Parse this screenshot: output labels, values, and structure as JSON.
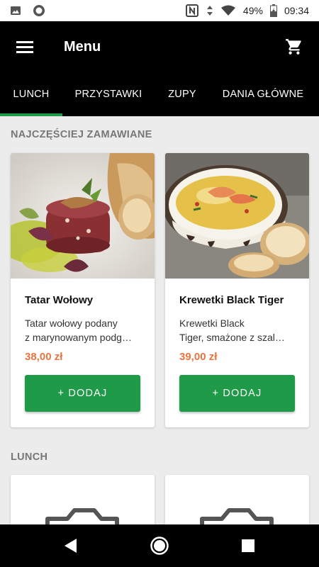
{
  "status_bar": {
    "battery": "49%",
    "time": "09:34",
    "icons": [
      "image-icon",
      "record-icon",
      "nfc-icon",
      "data-arrows-icon",
      "wifi-icon",
      "battery-icon"
    ]
  },
  "toolbar": {
    "title": "Menu",
    "menu_icon": "hamburger-icon",
    "cart_icon": "cart-icon"
  },
  "tabs": [
    {
      "label": "LUNCH",
      "active": true
    },
    {
      "label": "PRZYSTAWKI",
      "active": false
    },
    {
      "label": "ZUPY",
      "active": false
    },
    {
      "label": "DANIA GŁÓWNE",
      "active": false
    }
  ],
  "colors": {
    "accent": "#1f9a48",
    "price": "#e8753f",
    "appbar": "#000000",
    "background": "#ececec"
  },
  "popular": {
    "title": "NAJCZĘŚCIEJ ZAMAWIANE",
    "items": [
      {
        "name": "Tatar Wołowy",
        "desc_line1": "Tatar wołowy podany",
        "desc_line2": "z marynowanym podg…",
        "price": "38,00 zł",
        "button": "+ DODAJ",
        "image": "beef-tartare-photo"
      },
      {
        "name": "Krewetki Black Tiger",
        "desc_line1": "Krewetki Black",
        "desc_line2": "Tiger, smażone z szal…",
        "price": "39,00 zł",
        "button": "+ DODAJ",
        "image": "shrimp-soup-photo"
      }
    ]
  },
  "lunch": {
    "title": "LUNCH",
    "placeholder_icon": "camera-placeholder-icon"
  },
  "nav": {
    "back": "back-icon",
    "home": "home-icon",
    "recents": "recents-icon"
  }
}
